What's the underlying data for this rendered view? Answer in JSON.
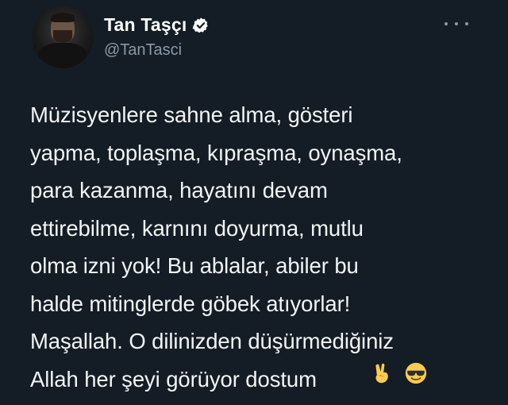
{
  "tweet": {
    "display_name": "Tan Taşçı",
    "handle": "@TanTasci",
    "text": "Müzisyenlere sahne alma, gösteri\nyapma, toplaşma, kıpraşma, oynaşma,\npara kazanma, hayatını devam\nettirebilme, karnını doyurma, mutlu\nolma izni yok! Bu ablalar, abiler bu\nhalde mitinglerde göbek atıyorlar!\nMaşallah. O dilinizden düşürmediğiniz\nAllah her şeyi görüyor dostum",
    "emojis": [
      "victory-hand-emoji",
      "sunglasses-face-emoji"
    ]
  },
  "icons": {
    "verified": "verified-badge-icon",
    "more": "more-options-icon"
  },
  "colors": {
    "background": "#141d26",
    "primary_text": "#ffffff",
    "secondary_text": "#8899a6",
    "verified": "#ffffff"
  }
}
